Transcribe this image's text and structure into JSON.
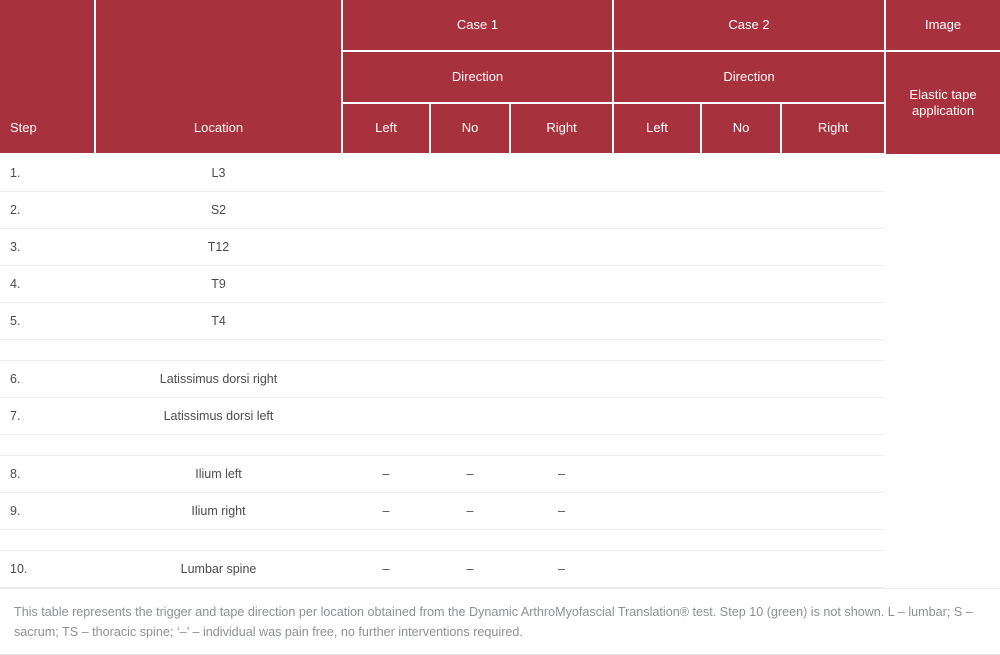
{
  "theme": {
    "header_bg": "#a8313e",
    "header_text": "#ffffff",
    "body_text": "#4c4c4c",
    "row_line": "#eceded",
    "footnote_text": "#8d9093"
  },
  "header": {
    "group_blank_1": "",
    "group_blank_2": "",
    "case_1": "Case 1",
    "case_2": "Case 2",
    "image": "Image",
    "direction_1": "Direction",
    "direction_2": "Direction",
    "elastic_tape": "Elastic tape application",
    "step": "Step",
    "location": "Location",
    "case1_left": "Left",
    "case1_no": "No",
    "case1_right": "Right",
    "case2_left": "Left",
    "case2_no": "No",
    "case2_right": "Right"
  },
  "rows": [
    {
      "step": "1.",
      "location": "L3",
      "c1l": "",
      "c1n": "",
      "c1r": "",
      "c2l": "",
      "c2n": "",
      "c2r": ""
    },
    {
      "step": "2.",
      "location": "S2",
      "c1l": "",
      "c1n": "",
      "c1r": "",
      "c2l": "",
      "c2n": "",
      "c2r": ""
    },
    {
      "step": "3.",
      "location": "T12",
      "c1l": "",
      "c1n": "",
      "c1r": "",
      "c2l": "",
      "c2n": "",
      "c2r": ""
    },
    {
      "step": "4.",
      "location": "T9",
      "c1l": "",
      "c1n": "",
      "c1r": "",
      "c2l": "",
      "c2n": "",
      "c2r": ""
    },
    {
      "step": "5.",
      "location": "T4",
      "c1l": "",
      "c1n": "",
      "c1r": "",
      "c2l": "",
      "c2n": "",
      "c2r": ""
    },
    {
      "step": "6.",
      "location": "Latissimus dorsi right",
      "c1l": "",
      "c1n": "",
      "c1r": "",
      "c2l": "",
      "c2n": "",
      "c2r": ""
    },
    {
      "step": "7.",
      "location": "Latissimus dorsi left",
      "c1l": "",
      "c1n": "",
      "c1r": "",
      "c2l": "",
      "c2n": "",
      "c2r": ""
    },
    {
      "step": "8.",
      "location": "Ilium left",
      "c1l": "–",
      "c1n": "–",
      "c1r": "–",
      "c2l": "",
      "c2n": "",
      "c2r": ""
    },
    {
      "step": "9.",
      "location": "Ilium right",
      "c1l": "–",
      "c1n": "–",
      "c1r": "–",
      "c2l": "",
      "c2n": "",
      "c2r": ""
    },
    {
      "step": "10.",
      "location": "Lumbar spine",
      "c1l": "–",
      "c1n": "–",
      "c1r": "–",
      "c2l": "",
      "c2n": "",
      "c2r": ""
    }
  ],
  "footnote": {
    "text": "This table represents the trigger and tape direction per location obtained from the Dynamic ArthroMyofascial Translation® test. Step 10 (green) is not shown. L – lumbar; S – sacrum; TS – thoracic spine; ‘–’ – individual was pain free, no further interventions required."
  }
}
